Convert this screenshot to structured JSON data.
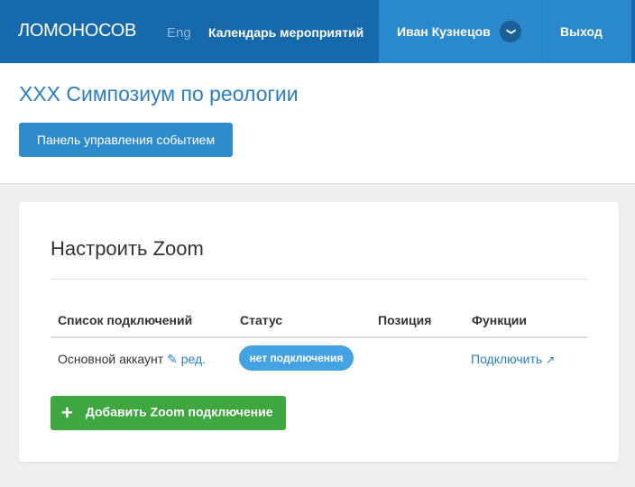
{
  "nav": {
    "logo": "ЛОМОНОСОВ",
    "lang": "Eng",
    "calendar": "Календарь мероприятий",
    "user": "Иван Кузнецов",
    "logout": "Выход"
  },
  "event": {
    "title": "XXX Симпозиум по реологии",
    "panel_button": "Панель управления событием"
  },
  "zoom": {
    "heading": "Настроить Zoom",
    "columns": [
      "Список подключений",
      "Статус",
      "Позиция",
      "Функции"
    ],
    "rows": [
      {
        "name": "Основной аккаунт",
        "edit": "ред.",
        "status": "нет подключения",
        "position": "",
        "action": "Подключить"
      }
    ],
    "add_button": "Добавить Zoom подключение"
  },
  "colors": {
    "nav": "#1669aa",
    "nav_active": "#2a89cc",
    "link": "#2a7fc4",
    "badge": "#45a3e3",
    "add": "#3fa73f"
  }
}
